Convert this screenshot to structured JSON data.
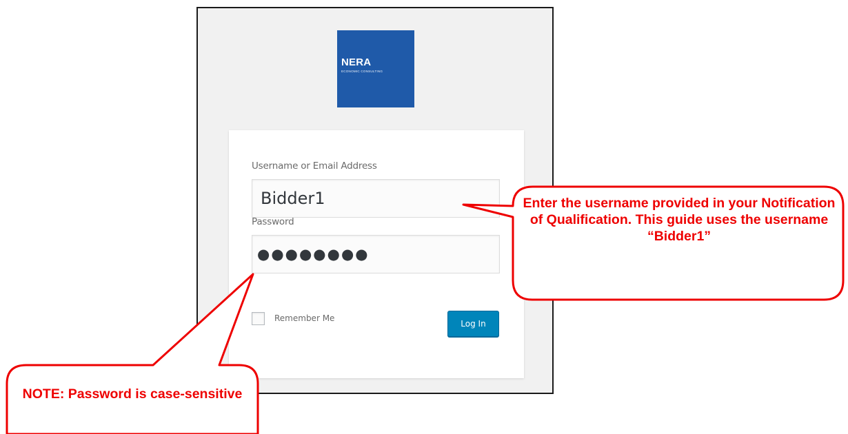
{
  "logo": {
    "title": "NERA",
    "subtitle": "ECONOMIC CONSULTING"
  },
  "login": {
    "username_label": "Username or Email Address",
    "username_value": "Bidder1",
    "password_label": "Password",
    "password_value": "●●●●●●●●",
    "remember_label": "Remember Me",
    "login_button": "Log In"
  },
  "callouts": {
    "username_note": "Enter the username provided in your Notification of Qualification. This guide uses the username “Bidder1”",
    "password_note": "NOTE:  Password is case-sensitive"
  },
  "colors": {
    "callout_red": "#ee0000",
    "logo_blue": "#1f5aa9",
    "button_blue": "#0085ba"
  }
}
